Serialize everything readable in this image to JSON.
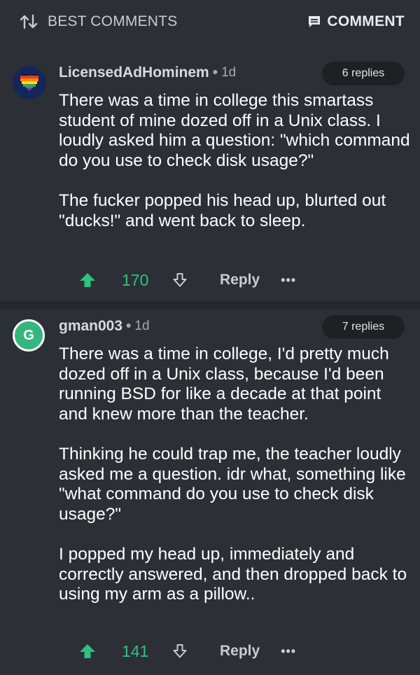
{
  "header": {
    "sort_label": "BEST COMMENTS",
    "comment_label": "COMMENT",
    "sort_icon": "sort-arrows-icon",
    "comment_icon": "comment-bubble-icon"
  },
  "colors": {
    "background": "#2d2f36",
    "upvote": "#2ec27e",
    "avatar_green": "#33b77f",
    "avatar_navy": "#15275a"
  },
  "comments": [
    {
      "username": "LicensedAdHominem",
      "age": "1d",
      "replies": "6 replies",
      "avatar_icon": "rainbow-pixel-heart-icon",
      "paragraphs": [
        "There was a time in college this smartass student of mine dozed off in a Unix class. I loudly asked him a question: \"which command do you use to check disk usage?\"",
        "The fucker popped his head up, blurted out \"ducks!\" and went back to sleep."
      ],
      "score": "170",
      "reply_label": "Reply",
      "more_label": "•••"
    },
    {
      "username": "gman003",
      "age": "1d",
      "replies": "7 replies",
      "avatar_letter": "G",
      "paragraphs": [
        "There was a time in college, I'd pretty much dozed off in a Unix class, because I'd been running BSD for like a decade at that point and knew more than the teacher.",
        "Thinking he could trap me, the teacher loudly asked me a question. idr what, something like \"what command do you use to check disk usage?\"",
        "I popped my head up, immediately and correctly answered, and then dropped back to using my arm as a pillow.."
      ],
      "score": "141",
      "reply_label": "Reply",
      "more_label": "•••"
    }
  ]
}
